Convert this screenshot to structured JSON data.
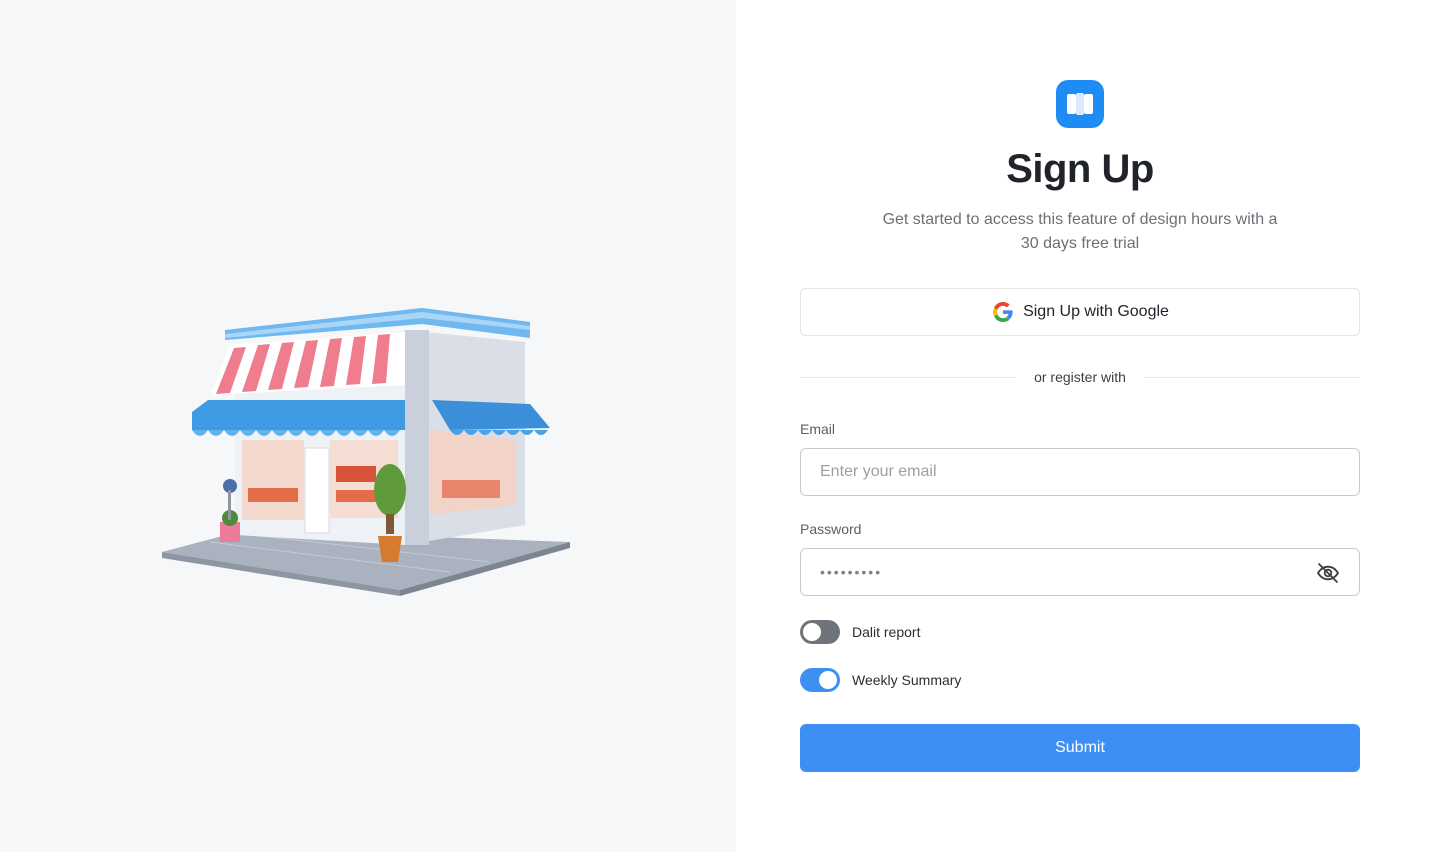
{
  "brand": {
    "accent": "#3d8ff4",
    "logo_color": "#1f8bf5"
  },
  "header": {
    "title": "Sign Up",
    "subtitle": "Get started to access this feature of design hours with a 30 days free trial"
  },
  "google_signup": {
    "label": "Sign Up with Google",
    "icon": "google-g-icon"
  },
  "divider": {
    "text": "or register with"
  },
  "form": {
    "email": {
      "label": "Email",
      "placeholder": "Enter your email",
      "value": ""
    },
    "password": {
      "label": "Password",
      "value": "•••••••••",
      "toggle_icon": "eye-off-icon"
    },
    "toggles": [
      {
        "label": "Dalit report",
        "on": false
      },
      {
        "label": "Weekly Summary",
        "on": true
      }
    ],
    "submit_label": "Submit"
  },
  "illustration": {
    "subject": "store-front-illustration"
  }
}
